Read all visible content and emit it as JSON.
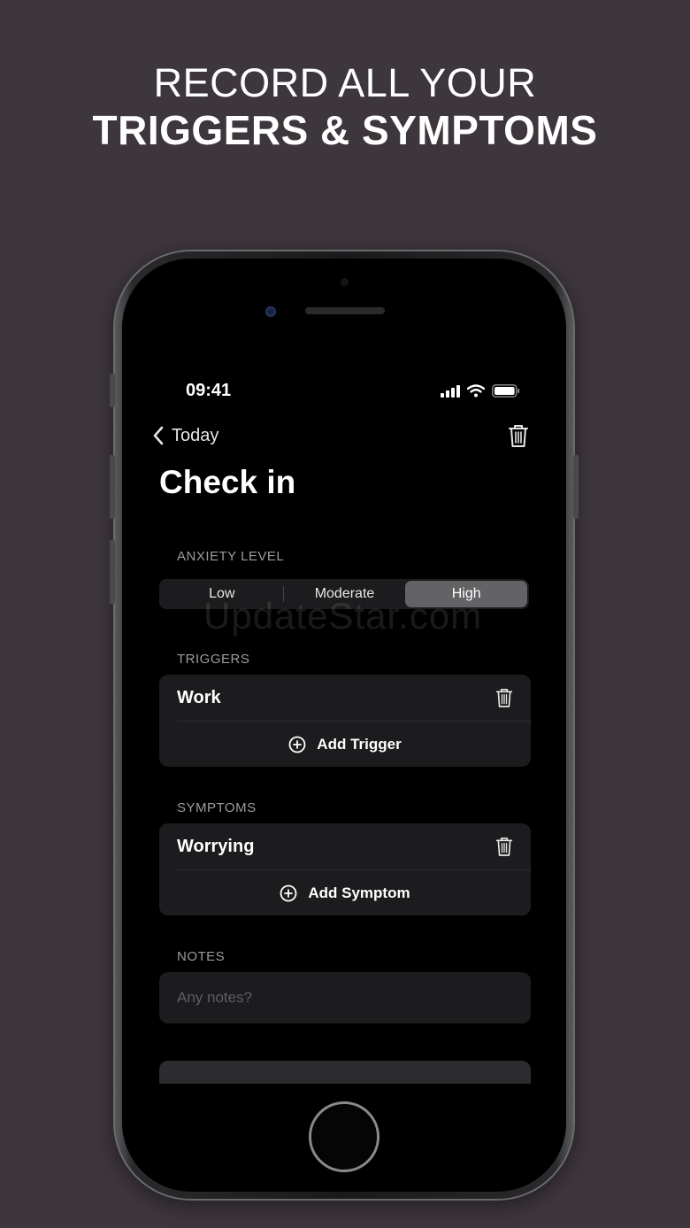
{
  "promo": {
    "line1": "RECORD ALL YOUR",
    "line2": "TRIGGERS & SYMPTOMS"
  },
  "status_bar": {
    "time": "09:41",
    "icons": [
      "cellular-signal-icon",
      "wifi-icon",
      "battery-icon"
    ]
  },
  "nav": {
    "back_label": "Today",
    "delete_icon": "trash-icon"
  },
  "page": {
    "title": "Check in"
  },
  "anxiety": {
    "label": "ANXIETY LEVEL",
    "options": [
      "Low",
      "Moderate",
      "High"
    ],
    "selected": "High"
  },
  "triggers": {
    "label": "TRIGGERS",
    "items": [
      "Work"
    ],
    "add_label": "Add Trigger"
  },
  "symptoms": {
    "label": "SYMPTOMS",
    "items": [
      "Worrying"
    ],
    "add_label": "Add Symptom"
  },
  "notes": {
    "label": "NOTES",
    "placeholder": "Any notes?"
  },
  "watermark": "UpdateStar.com",
  "colors": {
    "background": "#3d363d",
    "screen": "#000000",
    "card": "#1c1c1e",
    "selected_segment": "#636366",
    "section_label": "#9c9ca1"
  }
}
